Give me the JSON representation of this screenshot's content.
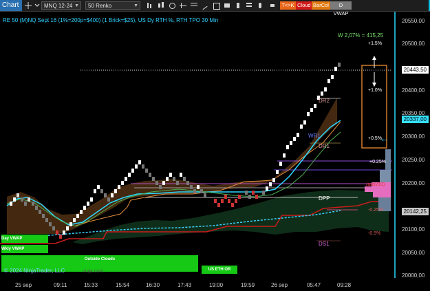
{
  "toolbar": {
    "tab_title": "Chart",
    "instrument": "MNQ 12-24",
    "bar_type": "50 Renko",
    "indicator_buttons": [
      {
        "label": "T<>K",
        "color": "#e8661a"
      },
      {
        "label": "Cloud",
        "color": "#d11a1a"
      },
      {
        "label": "BarCol",
        "color": "#e07a10"
      },
      {
        "label": "D VWAP",
        "color": "#7b7b7b"
      }
    ]
  },
  "chart": {
    "header": "RE 50 (M)NQ Sept 16 (1%=200p=$400) (1 Brick=$25), US Dy RTH %, RTH TPO 30 Min",
    "copyright": "© 2024 NinjaTrader, LLC",
    "watermark": "ninja.com",
    "week_label": "W 2,07% = 415,25",
    "price_axis": [
      "20550,00",
      "20500,00",
      "20450,00",
      "20400,00",
      "20350,00",
      "20300,00",
      "20250,00",
      "20200,00",
      "20150,00",
      "20100,00",
      "20050,00",
      "20000,00"
    ],
    "time_axis": [
      "25 sep",
      "09:11",
      "15:33",
      "15:54",
      "16:30",
      "17:43",
      "19:00",
      "19:59",
      "26 sep",
      "05:47",
      "09:28"
    ],
    "price_tags": [
      {
        "label": "20443,50",
        "bg": "#ffffff",
        "fg": "#000"
      },
      {
        "label": "20337,00",
        "bg": "#36e0ff",
        "fg": "#000"
      },
      {
        "label": "20142,25",
        "bg": "#c9c9c9",
        "fg": "#000"
      }
    ],
    "levels": [
      "DR2",
      "WR1",
      "DR1",
      "DPP",
      "DS1"
    ],
    "percent_marks": [
      "+1.5%",
      "+1.0%",
      "+0.5%",
      "+0.25%",
      "-0.25%",
      "-0.5%"
    ],
    "bottom_boxes": [
      "Day VWAP",
      "Wkly VWAP",
      "Outside Clouds",
      "US ETH OR"
    ],
    "misc": "(ausv10)"
  }
}
